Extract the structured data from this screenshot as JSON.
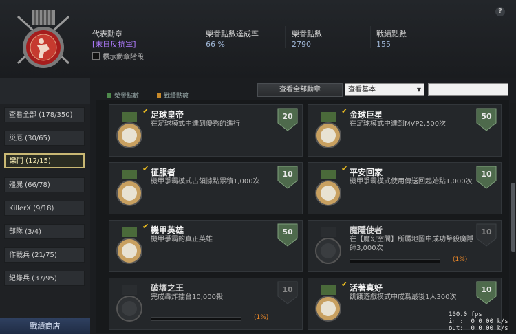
{
  "header": {
    "help_label": "?",
    "rep_badge_label": "代表勳章",
    "rep_badge_name": "[末日反抗軍]",
    "show_stage_label": "標示勳章階段",
    "rate_label": "榮譽點數達成率",
    "rate_value": "66 %",
    "honor_label": "榮譽點數",
    "honor_value": "2790",
    "record_label": "戰績點數",
    "record_value": "155"
  },
  "legend": {
    "honor": "榮譽點數",
    "record": "戰績點數"
  },
  "toolbar": {
    "view_all": "查看全部勳章",
    "select_value": "查看基本",
    "search_placeholder": ""
  },
  "sidebar": {
    "items": [
      {
        "label": "查看全部 (178/350)"
      },
      {
        "label": "災厄 (30/65)"
      },
      {
        "label": "樂鬥 (12/15)"
      },
      {
        "label": "殭屍 (66/78)"
      },
      {
        "label": "KillerX (9/18)"
      },
      {
        "label": "部隊 (3/4)"
      },
      {
        "label": "作戰兵 (21/75)"
      },
      {
        "label": "紀錄兵 (37/95)"
      }
    ],
    "shop_label": "戰績商店"
  },
  "cards": [
    {
      "title": "足球皇帝",
      "desc": "在足球模式中達到優秀的進行",
      "points": "20",
      "achieved": true,
      "progress": ""
    },
    {
      "title": "金球巨星",
      "desc": "在足球模式中達到MVP2,500次",
      "points": "50",
      "achieved": true,
      "progress": ""
    },
    {
      "title": "征服者",
      "desc": "機甲爭霸模式占領據點累積1,000次",
      "points": "10",
      "achieved": true,
      "progress": ""
    },
    {
      "title": "平安回家",
      "desc": "機甲爭霸模式使用傳送回起始點1,000次",
      "points": "10",
      "achieved": true,
      "progress": ""
    },
    {
      "title": "機甲英雄",
      "desc": "機甲爭霸的真正英雄",
      "points": "50",
      "achieved": true,
      "progress": ""
    },
    {
      "title": "魔隱使者",
      "desc": "在【魔幻空間】所屬地圖中成功擊殺魔隱師3,000次",
      "points": "10",
      "achieved": false,
      "progress": "(1%)"
    },
    {
      "title": "破壞之王",
      "desc": "完成轟炸擂台10,000殺",
      "points": "10",
      "achieved": false,
      "progress": "(1%)"
    },
    {
      "title": "活著真好",
      "desc": "飢餓遊戲模式中成爲最後1人300次",
      "points": "10",
      "achieved": true,
      "progress": ""
    }
  ],
  "stats": {
    "fps": "100.0 fps",
    "in": "in :  0 0.00 k/s",
    "out": "out:  0 0.00 k/s"
  },
  "colors": {
    "accent_gold": "#c9b874",
    "rep_purple": "#b07cff",
    "progress_orange": "#f08a28",
    "points_green": "#4e6a4c"
  }
}
